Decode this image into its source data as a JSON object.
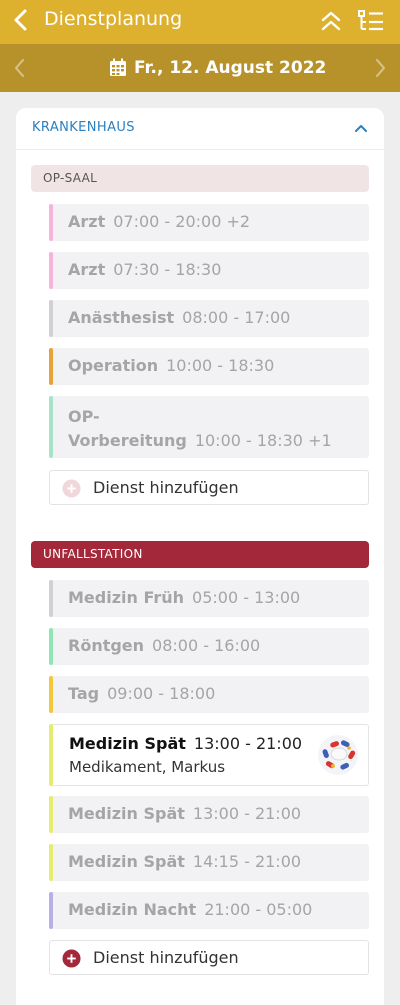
{
  "header": {
    "title": "Dienstplanung"
  },
  "datebar": {
    "date": "Fr., 12. August 2022"
  },
  "section": {
    "label": "KRANKENHAUS"
  },
  "groups": [
    {
      "name": "OP-SAAL",
      "shifts": [
        {
          "name": "Arzt",
          "time": "07:00 - 20:00 +2",
          "color": "#f6b3dc"
        },
        {
          "name": "Arzt",
          "time": "07:30 - 18:30",
          "color": "#f6b3dc"
        },
        {
          "name": "Anästhesist",
          "time": "08:00 - 17:00",
          "color": "#d0d0d2"
        },
        {
          "name": "Operation",
          "time": "10:00 - 18:30",
          "color": "#e8a23a"
        },
        {
          "name_line1": "OP-",
          "name_line2": "Vorbereitung",
          "time": "10:00 - 18:30 +1",
          "color": "#a7e3c6"
        }
      ],
      "add_label": "Dienst hinzufügen"
    },
    {
      "name": "UNFALLSTATION",
      "shifts": [
        {
          "name": "Medizin Früh",
          "time": "05:00 - 13:00",
          "color": "#d0d0d2"
        },
        {
          "name": "Röntgen",
          "time": "08:00 - 16:00",
          "color": "#8fe6b4"
        },
        {
          "name": "Tag",
          "time": "09:00 - 18:00",
          "color": "#f2c63d"
        },
        {
          "name": "Medizin Spät",
          "time": "13:00 - 21:00",
          "person": "Medikament, Markus",
          "color": "#e6ec6e"
        },
        {
          "name": "Medizin Spät",
          "time": "13:00 - 21:00",
          "color": "#e6ec6e"
        },
        {
          "name": "Medizin Spät",
          "time": "14:15 - 21:00",
          "color": "#e6ec6e"
        },
        {
          "name": "Medizin Nacht",
          "time": "21:00 - 05:00",
          "color": "#b9aee6"
        }
      ],
      "add_label": "Dienst hinzufügen"
    }
  ],
  "colors": {
    "header": "#ddb02e",
    "datebar": "#b7922a",
    "section_label": "#2a7fc0",
    "unfall_header": "#a3283a",
    "add_plus_active": "#a3283a",
    "add_plus_inactive": "#f0d7dc"
  },
  "icons": {
    "back": "chevron-left-icon",
    "collapse_all": "double-chevron-up-icon",
    "list": "checklist-icon",
    "calendar": "calendar-icon",
    "prev": "chevron-left-icon",
    "next": "chevron-right-icon",
    "section_toggle": "chevron-up-icon",
    "add": "plus-circle-icon",
    "avatar": "pills-avatar"
  }
}
